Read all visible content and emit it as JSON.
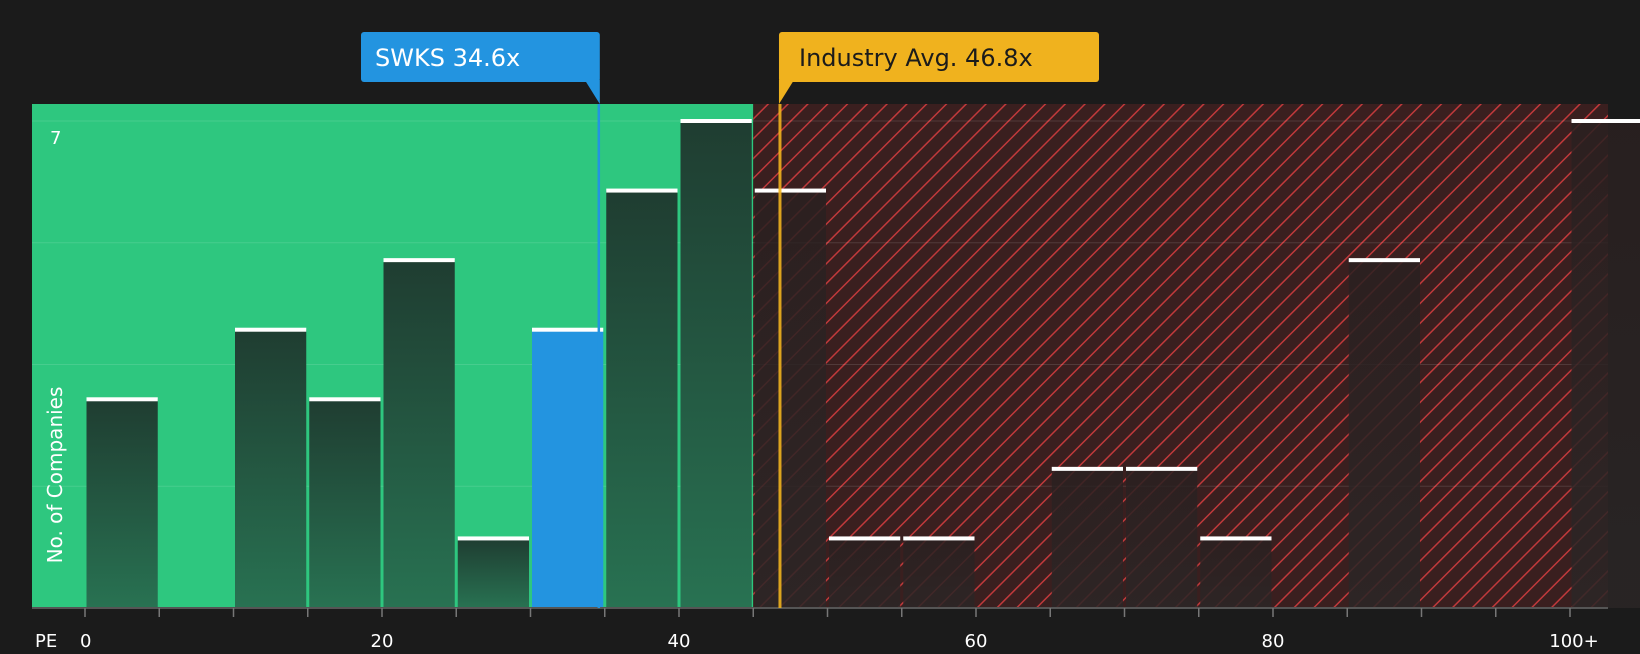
{
  "chart_data": {
    "type": "bar",
    "ylabel": "No. of Companies",
    "xlabel": "PE",
    "y_tick_label": "7",
    "ylim": [
      0,
      7
    ],
    "x_tick_labels": [
      "0",
      "20",
      "40",
      "60",
      "80",
      "100+"
    ],
    "bins": [
      {
        "x0": 0,
        "x1": 5,
        "value": 3
      },
      {
        "x0": 5,
        "x1": 10,
        "value": 0
      },
      {
        "x0": 10,
        "x1": 15,
        "value": 4
      },
      {
        "x0": 15,
        "x1": 20,
        "value": 3
      },
      {
        "x0": 20,
        "x1": 25,
        "value": 5
      },
      {
        "x0": 25,
        "x1": 30,
        "value": 1
      },
      {
        "x0": 30,
        "x1": 35,
        "value": 4,
        "highlight": true
      },
      {
        "x0": 35,
        "x1": 40,
        "value": 6
      },
      {
        "x0": 40,
        "x1": 45,
        "value": 7
      },
      {
        "x0": 45,
        "x1": 50,
        "value": 6
      },
      {
        "x0": 50,
        "x1": 55,
        "value": 1
      },
      {
        "x0": 55,
        "x1": 60,
        "value": 1
      },
      {
        "x0": 60,
        "x1": 65,
        "value": 0
      },
      {
        "x0": 65,
        "x1": 70,
        "value": 2
      },
      {
        "x0": 70,
        "x1": 75,
        "value": 2
      },
      {
        "x0": 75,
        "x1": 80,
        "value": 1
      },
      {
        "x0": 80,
        "x1": 85,
        "value": 0
      },
      {
        "x0": 85,
        "x1": 90,
        "value": 5
      },
      {
        "x0": 90,
        "x1": 95,
        "value": 0
      },
      {
        "x0": 95,
        "x1": 100,
        "value": 0
      },
      {
        "x0": 100,
        "x1": 105,
        "value": 7
      }
    ],
    "green_zone_until": 45,
    "company": {
      "label": "SWKS 34.6x",
      "value": 34.6
    },
    "industry": {
      "label": "Industry Avg. 46.8x",
      "value": 46.8
    },
    "colors": {
      "background": "#1b1b1b",
      "green_zone": "#2ec77f",
      "red_zone": "#3a1f1f",
      "hatch": "#c0393b",
      "highlight": "#2394e0",
      "industry": "#f0b21e",
      "bar_top": "#ffffff"
    }
  }
}
